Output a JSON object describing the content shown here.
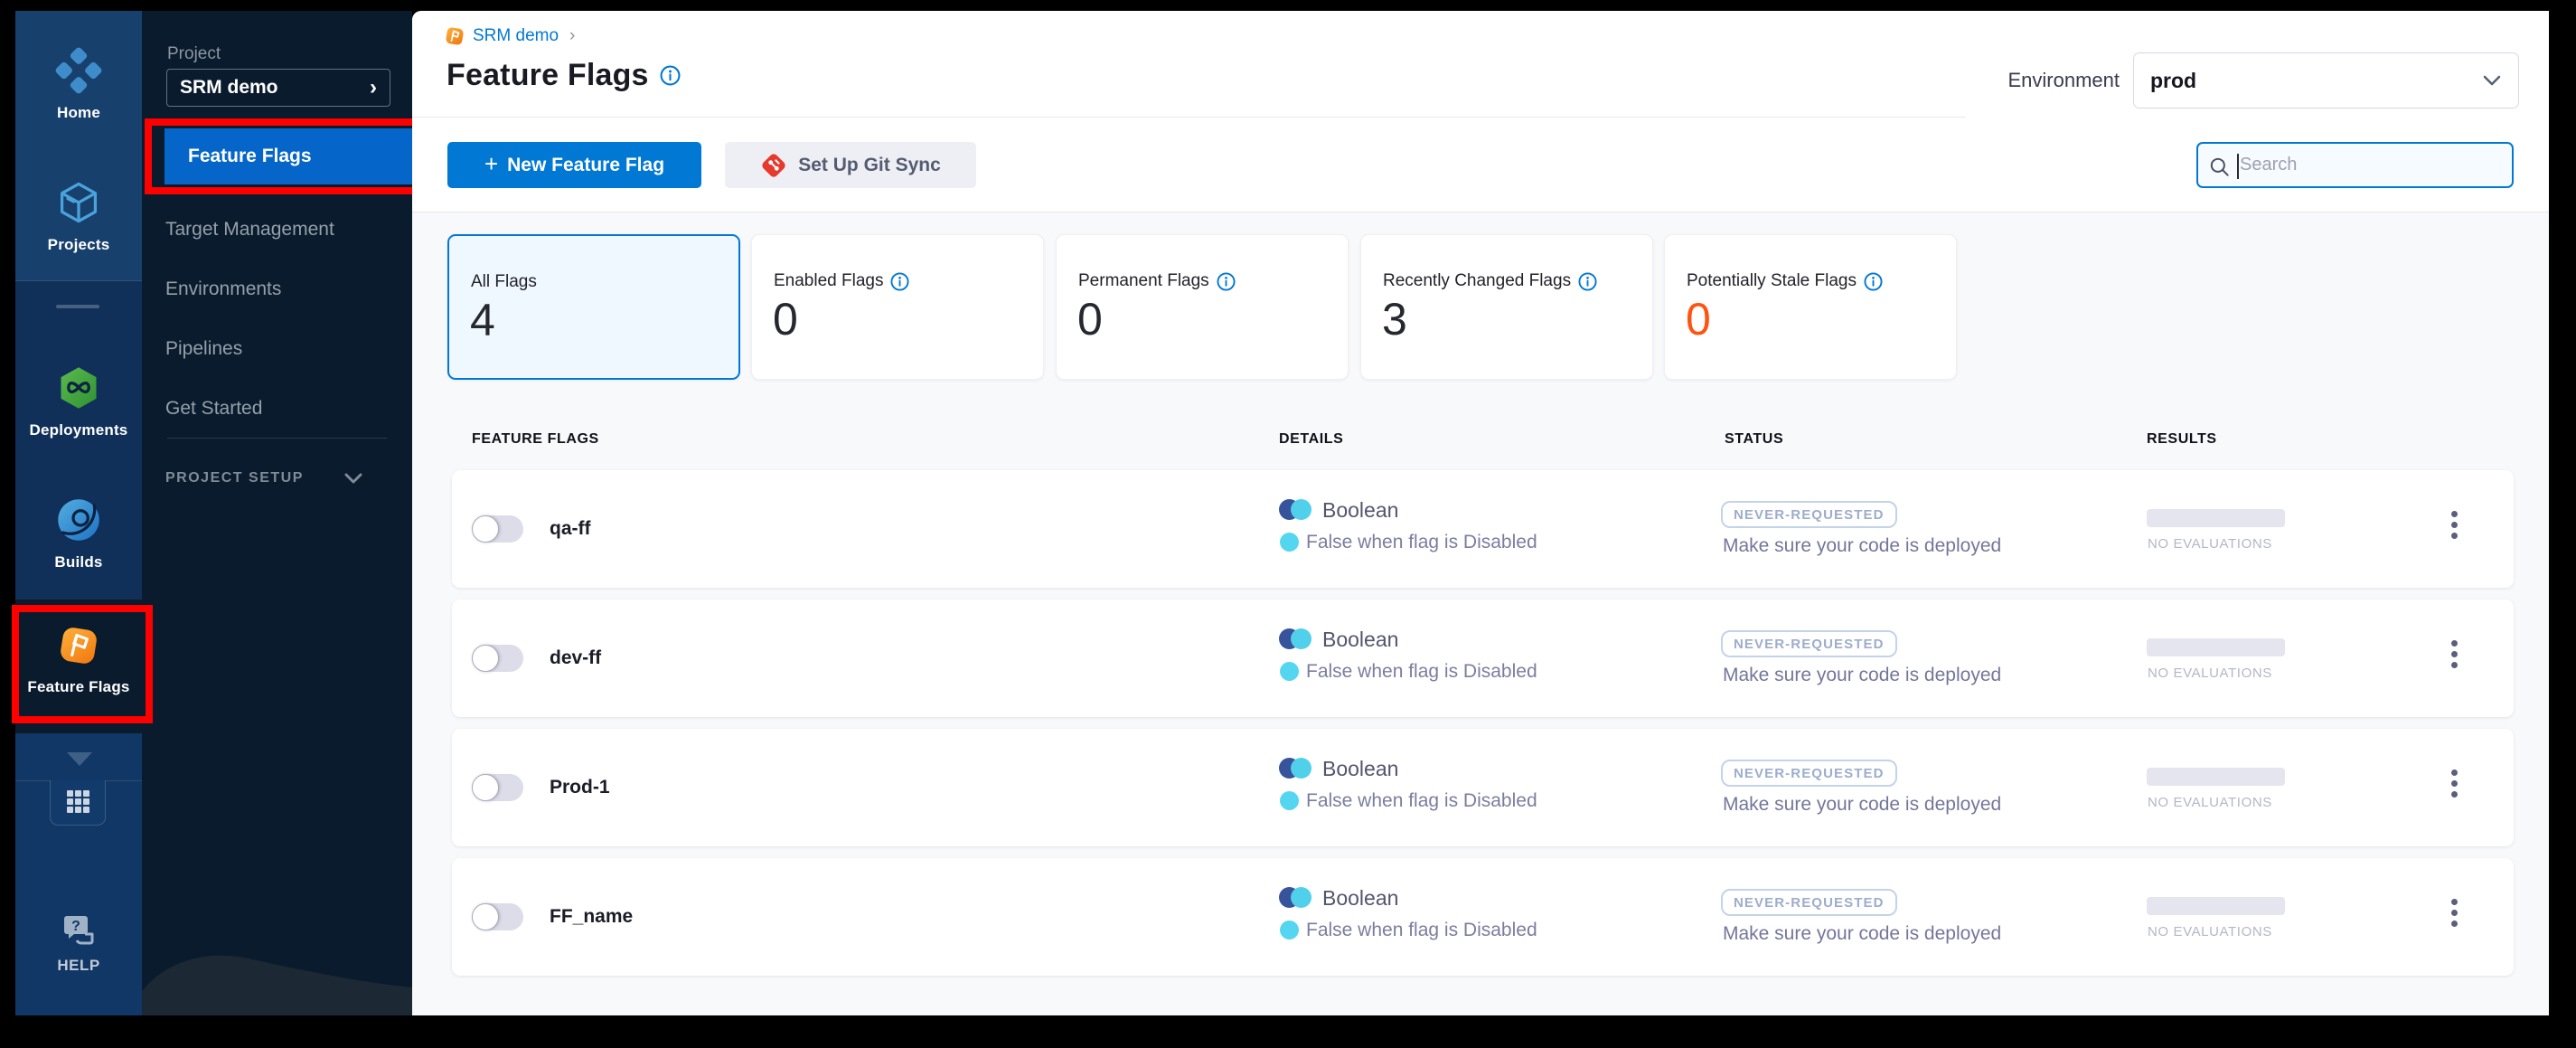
{
  "rail": {
    "items": [
      {
        "label": "Home"
      },
      {
        "label": "Projects"
      },
      {
        "label": "Deployments"
      },
      {
        "label": "Builds"
      },
      {
        "label": "Feature Flags"
      }
    ],
    "help_label": "HELP"
  },
  "subnav": {
    "section_label": "Project",
    "project_name": "SRM demo",
    "project_chevron": "›",
    "items": [
      {
        "label": "Feature Flags",
        "active": true
      },
      {
        "label": "Target Management",
        "active": false
      },
      {
        "label": "Environments",
        "active": false
      },
      {
        "label": "Pipelines",
        "active": false
      },
      {
        "label": "Get Started",
        "active": false
      }
    ],
    "footer_label": "PROJECT SETUP"
  },
  "header": {
    "breadcrumb": "SRM demo",
    "breadcrumb_sep": "›",
    "title": "Feature Flags",
    "environment_label": "Environment",
    "environment_value": "prod"
  },
  "toolbar": {
    "new_flag_plus": "+",
    "new_flag_label": "New Feature Flag",
    "git_sync_label": "Set Up Git Sync",
    "search_placeholder": "Search"
  },
  "stats": [
    {
      "label": "All Flags",
      "value": "4"
    },
    {
      "label": "Enabled Flags",
      "value": "0"
    },
    {
      "label": "Permanent Flags",
      "value": "0"
    },
    {
      "label": "Recently Changed Flags",
      "value": "3"
    },
    {
      "label": "Potentially Stale Flags",
      "value": "0"
    }
  ],
  "table": {
    "columns": [
      "FEATURE FLAGS",
      "DETAILS",
      "STATUS",
      "RESULTS"
    ],
    "rows": [
      {
        "name": "qa-ff",
        "type": "Boolean",
        "rule": "False when flag is Disabled",
        "status_badge": "NEVER-REQUESTED",
        "status_note": "Make sure your code is deployed",
        "results_note": "NO EVALUATIONS"
      },
      {
        "name": "dev-ff",
        "type": "Boolean",
        "rule": "False when flag is Disabled",
        "status_badge": "NEVER-REQUESTED",
        "status_note": "Make sure your code is deployed",
        "results_note": "NO EVALUATIONS"
      },
      {
        "name": "Prod-1",
        "type": "Boolean",
        "rule": "False when flag is Disabled",
        "status_badge": "NEVER-REQUESTED",
        "status_note": "Make sure your code is deployed",
        "results_note": "NO EVALUATIONS"
      },
      {
        "name": "FF_name",
        "type": "Boolean",
        "rule": "False when flag is Disabled",
        "status_badge": "NEVER-REQUESTED",
        "status_note": "Make sure your code is deployed",
        "results_note": "NO EVALUATIONS"
      }
    ]
  },
  "colors": {
    "accent_blue": "#0278D5",
    "stale_orange": "#FF5310",
    "sidebar_dark": "#0A1B2D",
    "annotation_red": "#FE0000",
    "boolean_navy": "#36539B",
    "boolean_cyan": "#50D0EA"
  }
}
